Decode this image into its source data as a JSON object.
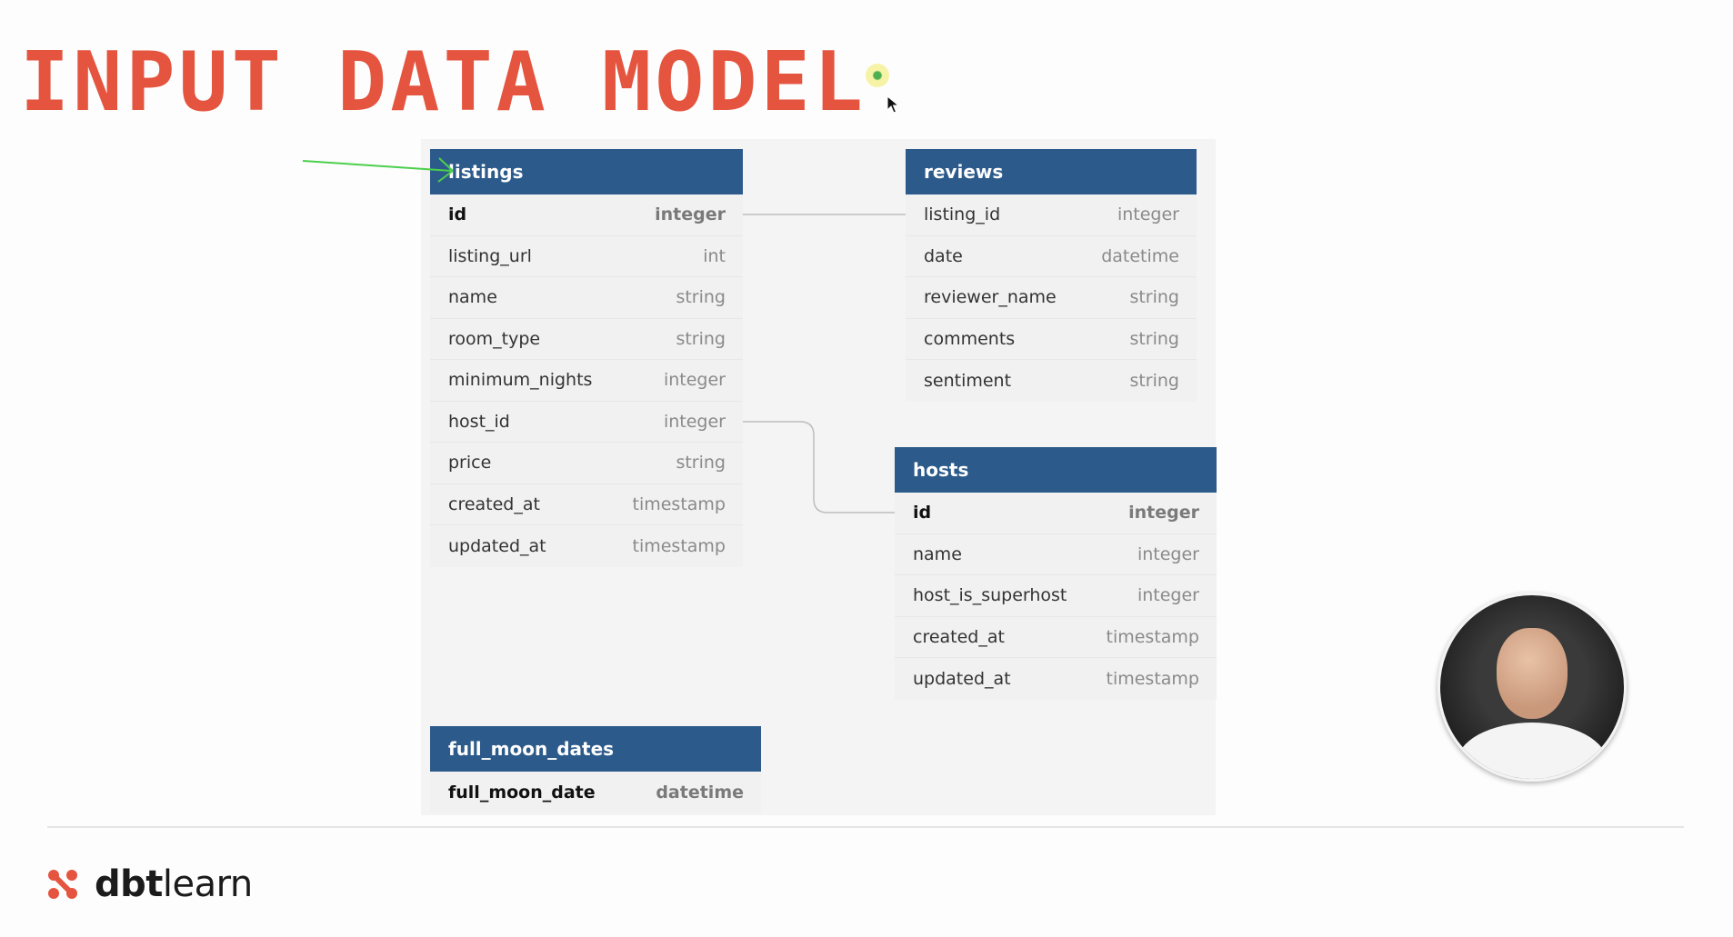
{
  "title": "INPUT DATA MODEL",
  "brand": {
    "name_bold": "dbt",
    "name_light": "learn",
    "accent": "#e4543f"
  },
  "colors": {
    "header": "#2c5a8a",
    "title": "#e4543f",
    "connector": "#bdbdbd",
    "annotation": "#4ccf4c"
  },
  "tables": {
    "listings": {
      "name": "listings",
      "fields": [
        {
          "name": "id",
          "type": "integer"
        },
        {
          "name": "listing_url",
          "type": "int"
        },
        {
          "name": "name",
          "type": "string"
        },
        {
          "name": "room_type",
          "type": "string"
        },
        {
          "name": "minimum_nights",
          "type": "integer"
        },
        {
          "name": "host_id",
          "type": "integer"
        },
        {
          "name": "price",
          "type": "string"
        },
        {
          "name": "created_at",
          "type": "timestamp"
        },
        {
          "name": "updated_at",
          "type": "timestamp"
        }
      ]
    },
    "reviews": {
      "name": "reviews",
      "fields": [
        {
          "name": "listing_id",
          "type": "integer"
        },
        {
          "name": "date",
          "type": "datetime"
        },
        {
          "name": "reviewer_name",
          "type": "string"
        },
        {
          "name": "comments",
          "type": "string"
        },
        {
          "name": "sentiment",
          "type": "string"
        }
      ]
    },
    "hosts": {
      "name": "hosts",
      "fields": [
        {
          "name": "id",
          "type": "integer"
        },
        {
          "name": "name",
          "type": "integer"
        },
        {
          "name": "host_is_superhost",
          "type": "integer"
        },
        {
          "name": "created_at",
          "type": "timestamp"
        },
        {
          "name": "updated_at",
          "type": "timestamp"
        }
      ]
    },
    "full_moon_dates": {
      "name": "full_moon_dates",
      "fields": [
        {
          "name": "full_moon_date",
          "type": "datetime"
        }
      ]
    }
  },
  "relationships": [
    {
      "from": "listings.id",
      "to": "reviews.listing_id"
    },
    {
      "from": "listings.host_id",
      "to": "hosts.id"
    }
  ]
}
